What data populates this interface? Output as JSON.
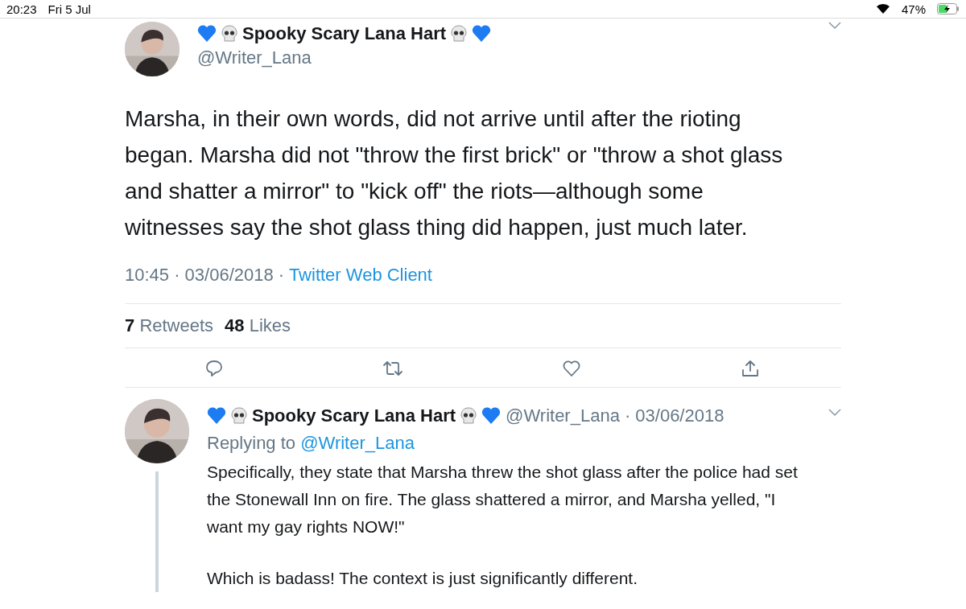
{
  "status_bar": {
    "time": "20:23",
    "date": "Fri 5 Jul",
    "battery": "47%",
    "charging": true
  },
  "tweet": {
    "name": "Spooky Scary Lana Hart",
    "handle": "@Writer_Lana",
    "text": "Marsha, in their own words, did not arrive until after the rioting began. Marsha did not \"throw the first brick\" or \"throw a shot glass and shatter a mirror\" to \"kick off\" the riots—although some witnesses say the shot glass thing did happen, just much later.",
    "time": "10:45 · 03/06/2018 · ",
    "source": "Twitter Web Client",
    "retweets": "7",
    "retweets_label": "Retweets",
    "likes": "48",
    "likes_label": "Likes"
  },
  "reply": {
    "name": "Spooky Scary Lana Hart",
    "handle": "@Writer_Lana",
    "date": "· 03/06/2018",
    "replying_label": "Replying to",
    "replying_to": "@Writer_Lana",
    "paragraphs": [
      "Specifically, they state that Marsha threw the shot glass after the police had set the Stonewall Inn on fire. The glass shattered a mirror, and Marsha yelled, \"I want my gay rights NOW!\"",
      "Which is badass! The context is just significantly different."
    ]
  }
}
